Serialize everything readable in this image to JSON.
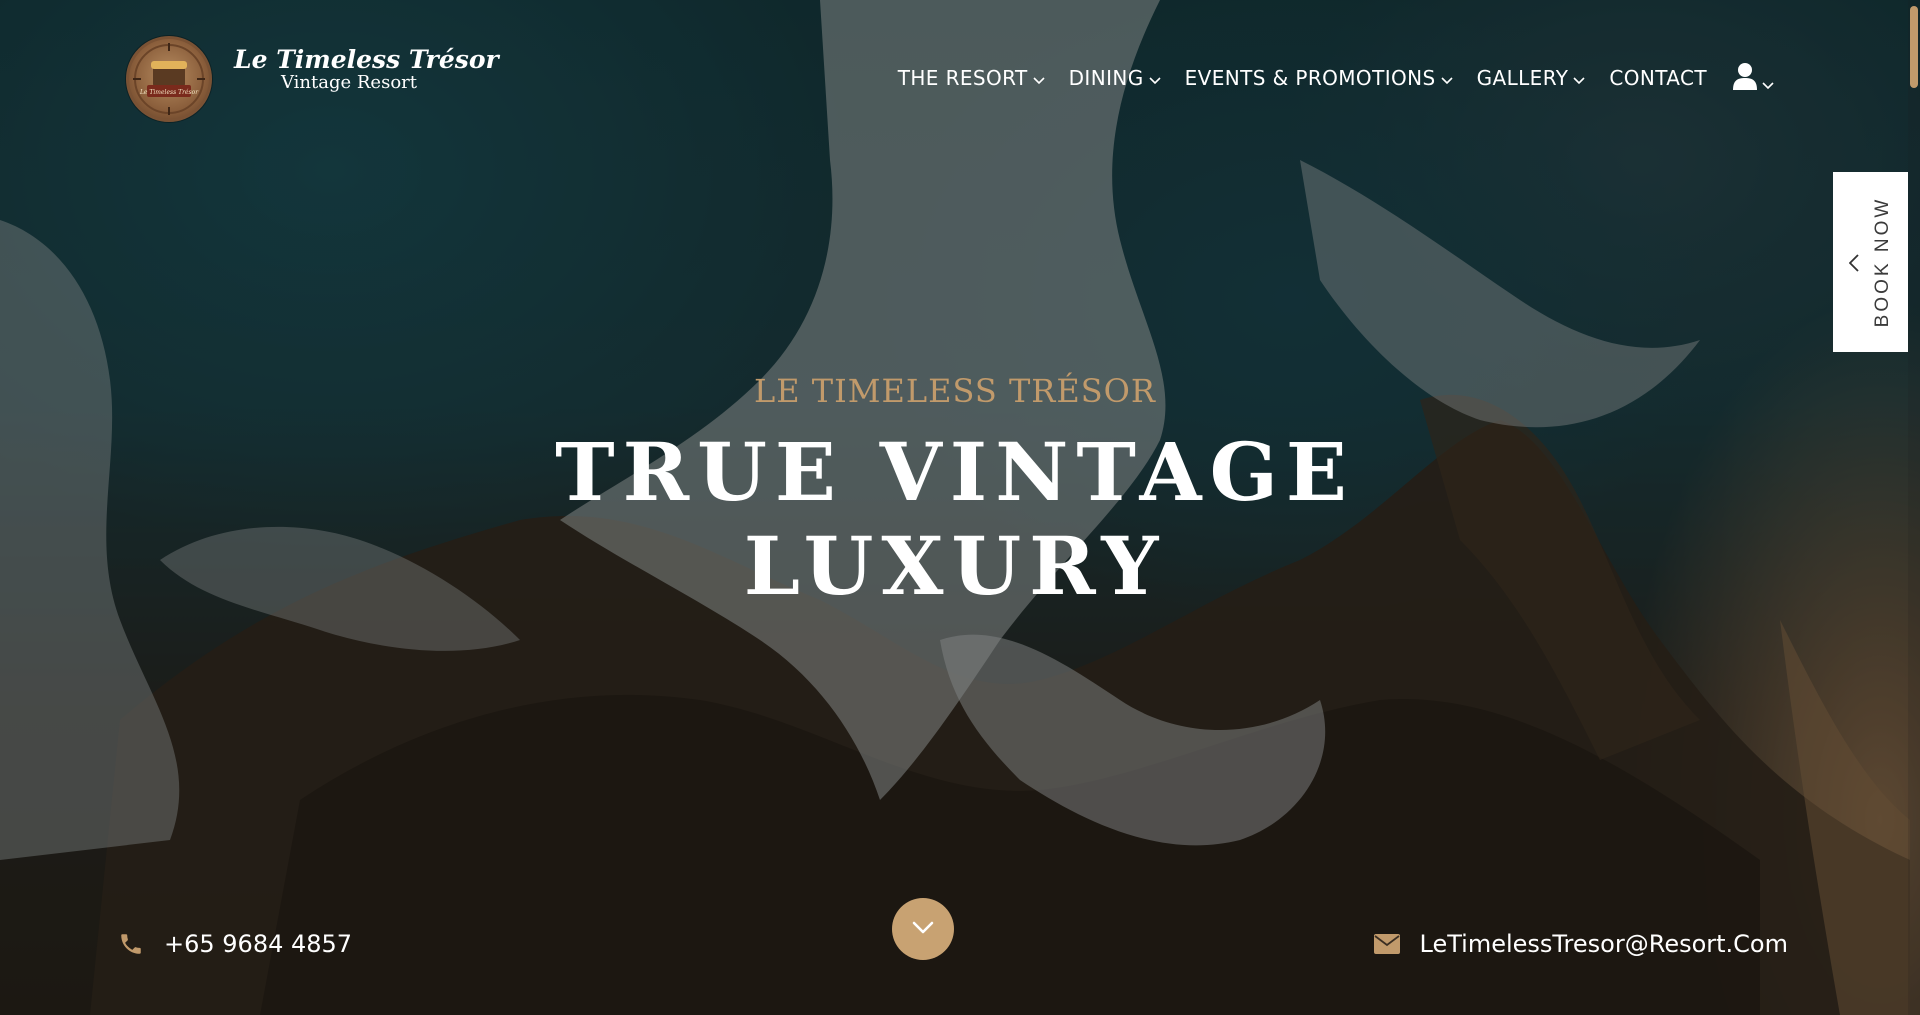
{
  "brand": {
    "name": "Le Timeless Trésor",
    "subtitle": "Vintage Resort",
    "logo_text": "Le Timeless Trésor"
  },
  "nav": {
    "items": [
      {
        "label": "THE RESORT",
        "has_dropdown": true
      },
      {
        "label": "DINING",
        "has_dropdown": true
      },
      {
        "label": "EVENTS & PROMOTIONS",
        "has_dropdown": true
      },
      {
        "label": "GALLERY",
        "has_dropdown": true
      },
      {
        "label": "CONTACT",
        "has_dropdown": false
      }
    ],
    "account_icon": "user-icon"
  },
  "book_now": {
    "label": "BOOK NOW",
    "icon": "chevron-left-icon"
  },
  "hero": {
    "kicker": "LE TIMELESS TRÉSOR",
    "title_line1": "TRUE VINTAGE",
    "title_line2": "LUXURY",
    "scroll_icon": "chevron-down-icon"
  },
  "contact": {
    "phone": "+65 9684 4857",
    "phone_icon": "phone-icon",
    "email": "LeTimelessTresor@Resort.Com",
    "email_icon": "envelope-icon"
  },
  "colors": {
    "accent": "#c19a6b",
    "text": "#ffffff",
    "book_bg": "#ffffff"
  }
}
